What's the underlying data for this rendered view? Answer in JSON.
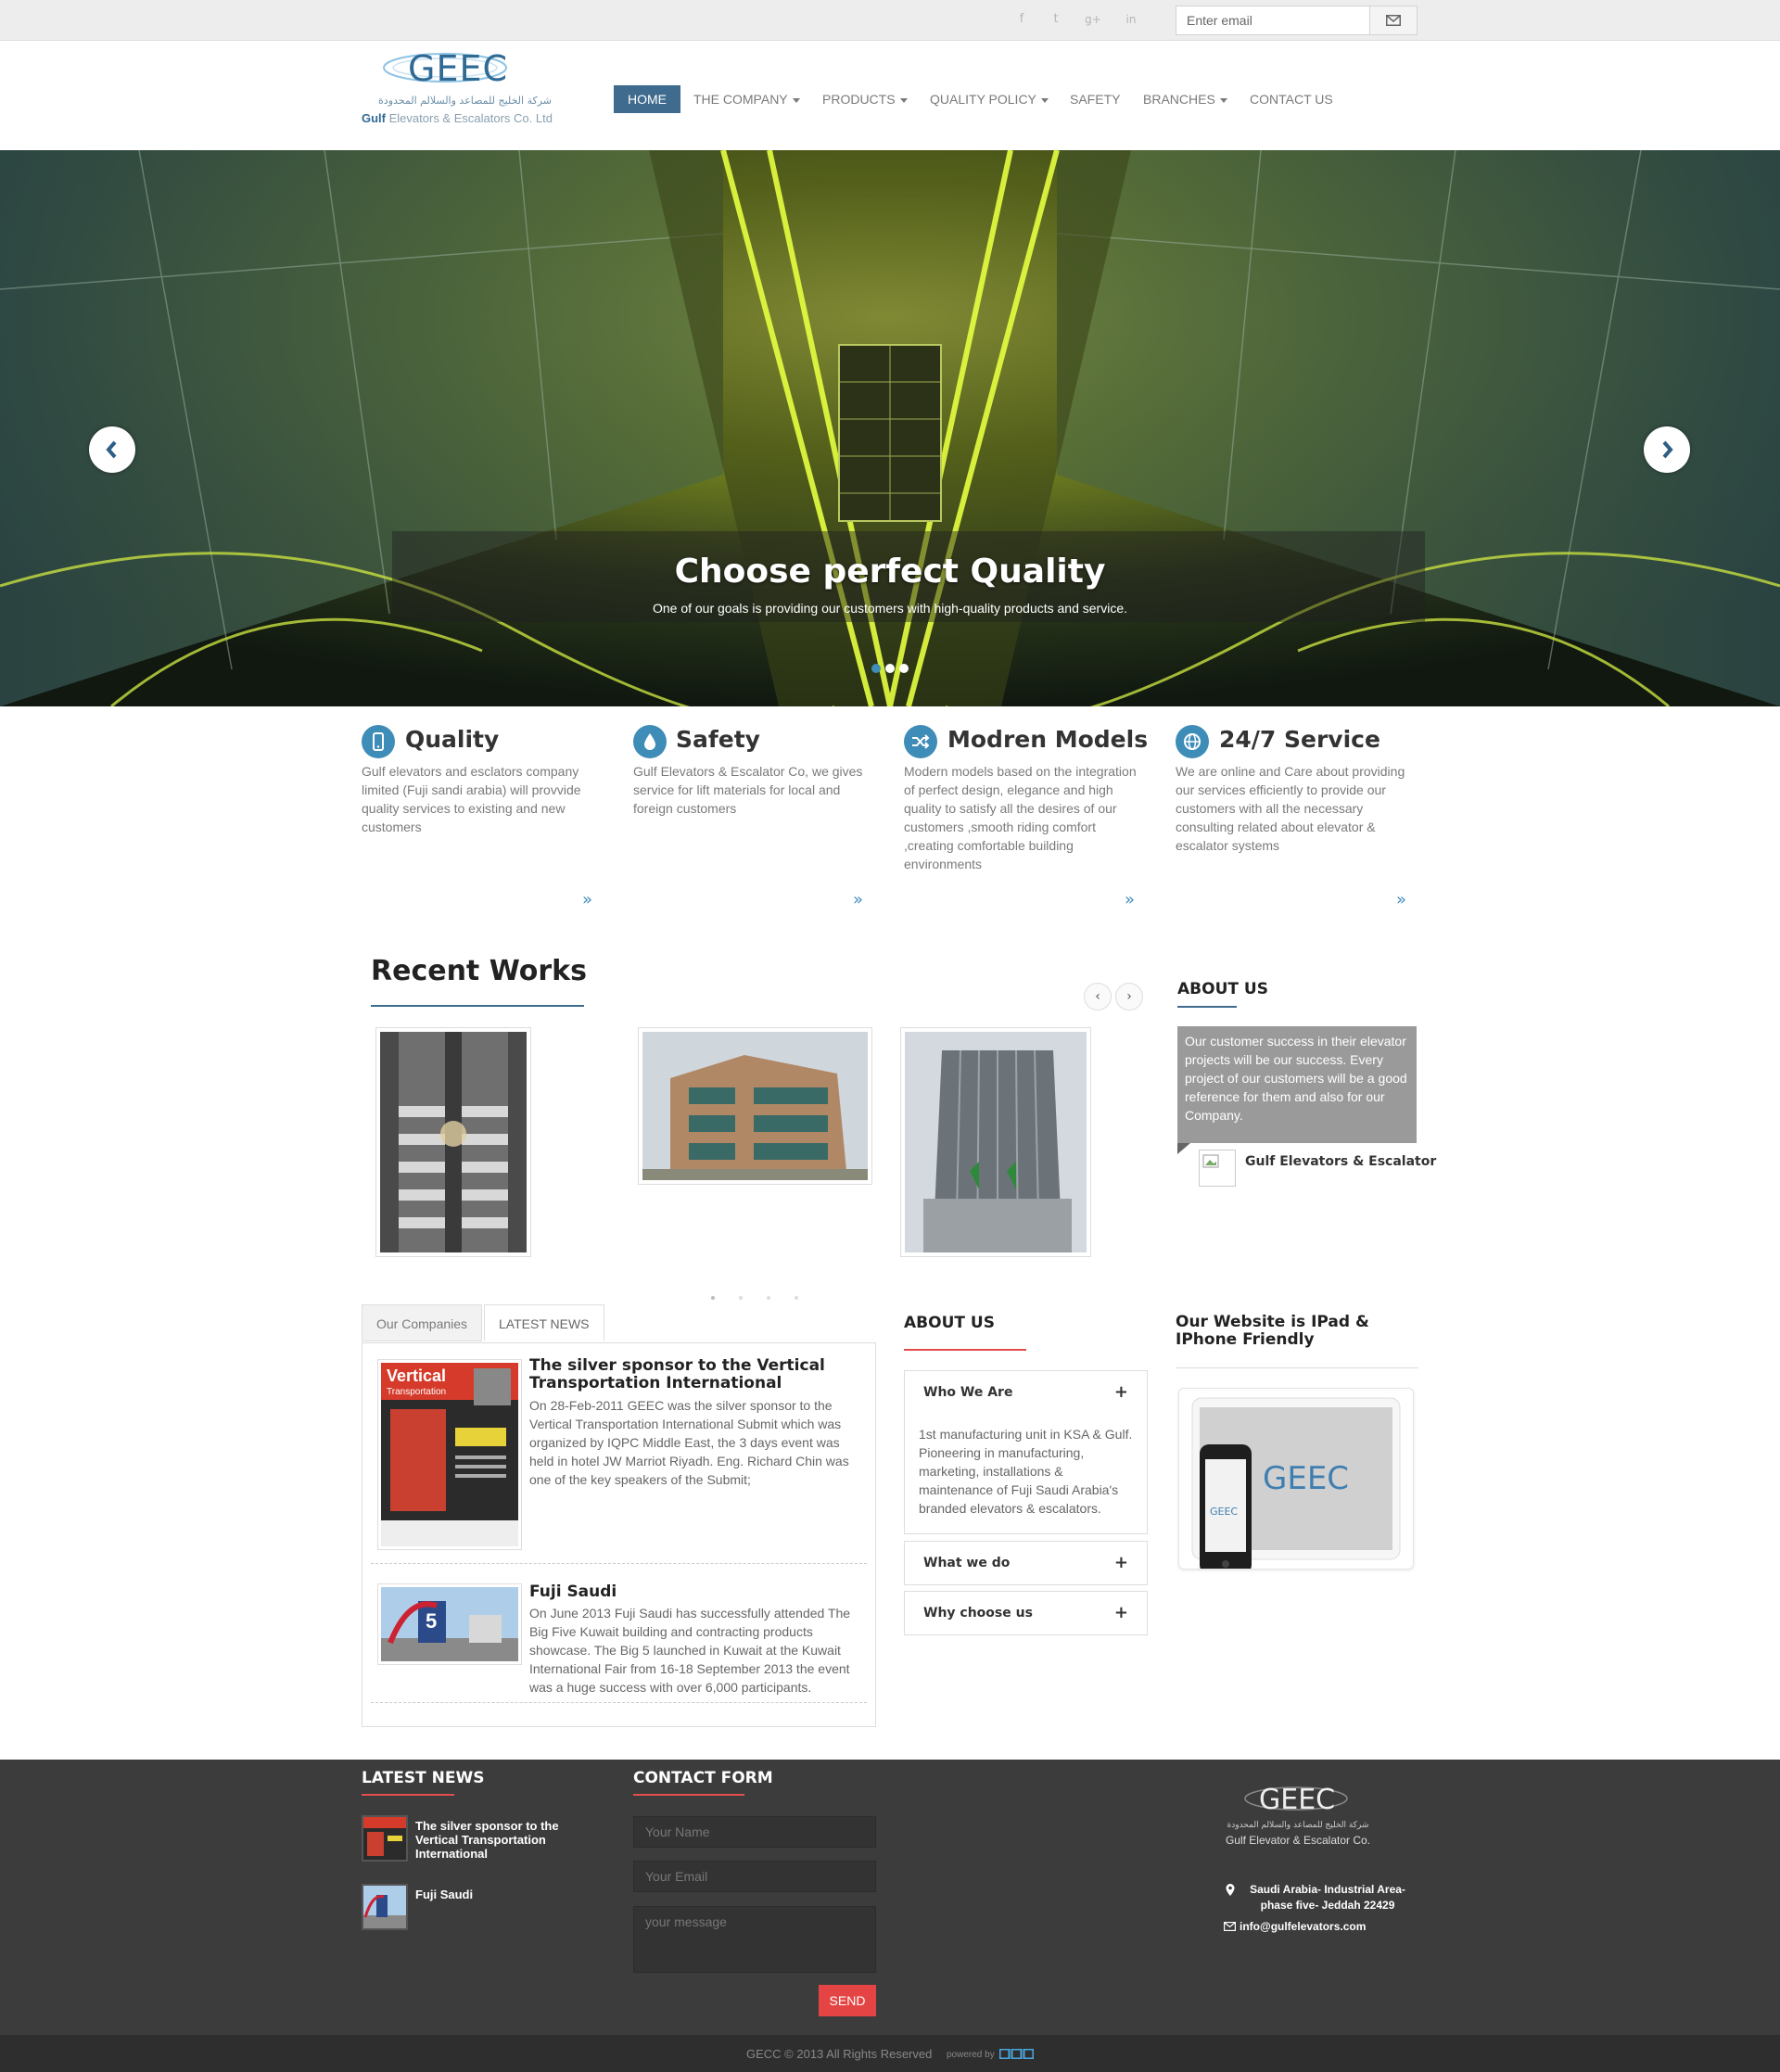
{
  "topbar": {
    "social_icons": [
      "facebook-icon",
      "twitter-icon",
      "google-plus-icon",
      "linkedin-icon"
    ],
    "email_placeholder": "Enter email"
  },
  "logo": {
    "name": "GEEC",
    "arabic": "شركة الخليج للمصاعد والسلالم المحدودة",
    "english_prefix": "Gulf",
    "english_rest": "Elevators & Escalators Co. Ltd"
  },
  "nav": [
    {
      "label": "HOME",
      "active": true,
      "dropdown": false
    },
    {
      "label": "THE COMPANY",
      "dropdown": true
    },
    {
      "label": "PRODUCTS",
      "dropdown": true
    },
    {
      "label": "QUALITY POLICY",
      "dropdown": true
    },
    {
      "label": "SAFETY",
      "dropdown": false
    },
    {
      "label": "BRANCHES",
      "dropdown": true
    },
    {
      "label": "CONTACT US",
      "dropdown": false
    }
  ],
  "hero": {
    "title": "Choose perfect Quality",
    "text": "One of our goals is providing our customers with high-quality products and service.",
    "slide_count": 3,
    "active_slide": 1
  },
  "features": [
    {
      "title": "Quality",
      "icon": "phone-icon",
      "text": "Gulf elevators and esclators company limited (Fuji sandi arabia) will provvide quality services to existing and new customers"
    },
    {
      "title": "Safety",
      "icon": "drop-icon",
      "text": "Gulf Elevators & Escalator Co, we gives service for lift materials for local and foreign customers"
    },
    {
      "title": "Modren Models",
      "icon": "shuffle-icon",
      "text": "Modern models based on the integration of perfect design, elegance and high quality to satisfy all the desires of our customers ,smooth riding comfort ,creating comfortable building environments"
    },
    {
      "title": "24/7 Service",
      "icon": "globe-icon",
      "text": "We are online and Care about providing our services efficiently to provide our customers with all the necessary consulting related about elevator & escalator systems"
    }
  ],
  "recent_works": {
    "title": "Recent Works",
    "prev": "‹",
    "next": "›"
  },
  "about_sidebar": {
    "title": "ABOUT US",
    "quote": "Our customer success in their elevator projects will be our success. Every project of our customers will be a good reference for them and also for our Company.",
    "author": "Gulf Elevators & Escalator"
  },
  "tabs": {
    "items": [
      "Our Companies",
      "LATEST NEWS"
    ],
    "active": 1
  },
  "news": [
    {
      "title": "The silver sponsor to the Vertical Transportation International",
      "text": "On 28-Feb-2011 GEEC was the silver sponsor to the Vertical Transportation International Submit which was organized by IQPC Middle East, the 3 days event was held in hotel JW Marriot Riyadh. Eng. Richard Chin was one of the key speakers of the Submit;",
      "thumb_title": "Vertical",
      "thumb_sub": "Transportation"
    },
    {
      "title": "Fuji Saudi",
      "text": "On June 2013 Fuji Saudi has successfully attended The Big Five Kuwait building and contracting products showcase. The Big 5 launched in Kuwait at the Kuwait International Fair from 16-18 September 2013 the event was a huge success with over 6,000 participants.",
      "thumb_badge": "5"
    }
  ],
  "about_accordion": {
    "title": "ABOUT US",
    "items": [
      {
        "label": "Who We Are",
        "toggle": "+",
        "body": "1st manufacturing unit in KSA & Gulf. Pioneering in manufacturing, marketing, installations & maintenance of Fuji Saudi Arabia's branded elevators & escalators."
      },
      {
        "label": "What we do",
        "toggle": "+"
      },
      {
        "label": "Why choose us",
        "toggle": "+"
      }
    ]
  },
  "mobile": {
    "title": "Our Website is IPad & IPhone Friendly",
    "logo_text": "GEEC"
  },
  "footer": {
    "latest_news_title": "LATEST NEWS",
    "news": [
      "The silver sponsor to the Vertical Transportation International",
      "Fuji Saudi"
    ],
    "contact_title": "CONTACT FORM",
    "name_placeholder": "Your Name",
    "email_placeholder": "Your Email",
    "message_placeholder": "your message",
    "send_label": "SEND",
    "logo_name": "GEEC",
    "logo_arabic": "شركة الخليج للمصاعد والسلالم المحدودة",
    "logo_english": "Gulf Elevator & Escalator Co.",
    "address": "Saudi Arabia- Industrial Area- phase five- Jeddah 22429",
    "email": "info@gulfelevators.com",
    "copyright": "GECC © 2013 All Rights Reserved",
    "powered_by": "powered by"
  },
  "colors": {
    "brand_blue": "#3e6b8e",
    "accent_blue": "#3e8cb8",
    "red": "#e54d4d",
    "footer_bg": "#3c3c3c"
  }
}
